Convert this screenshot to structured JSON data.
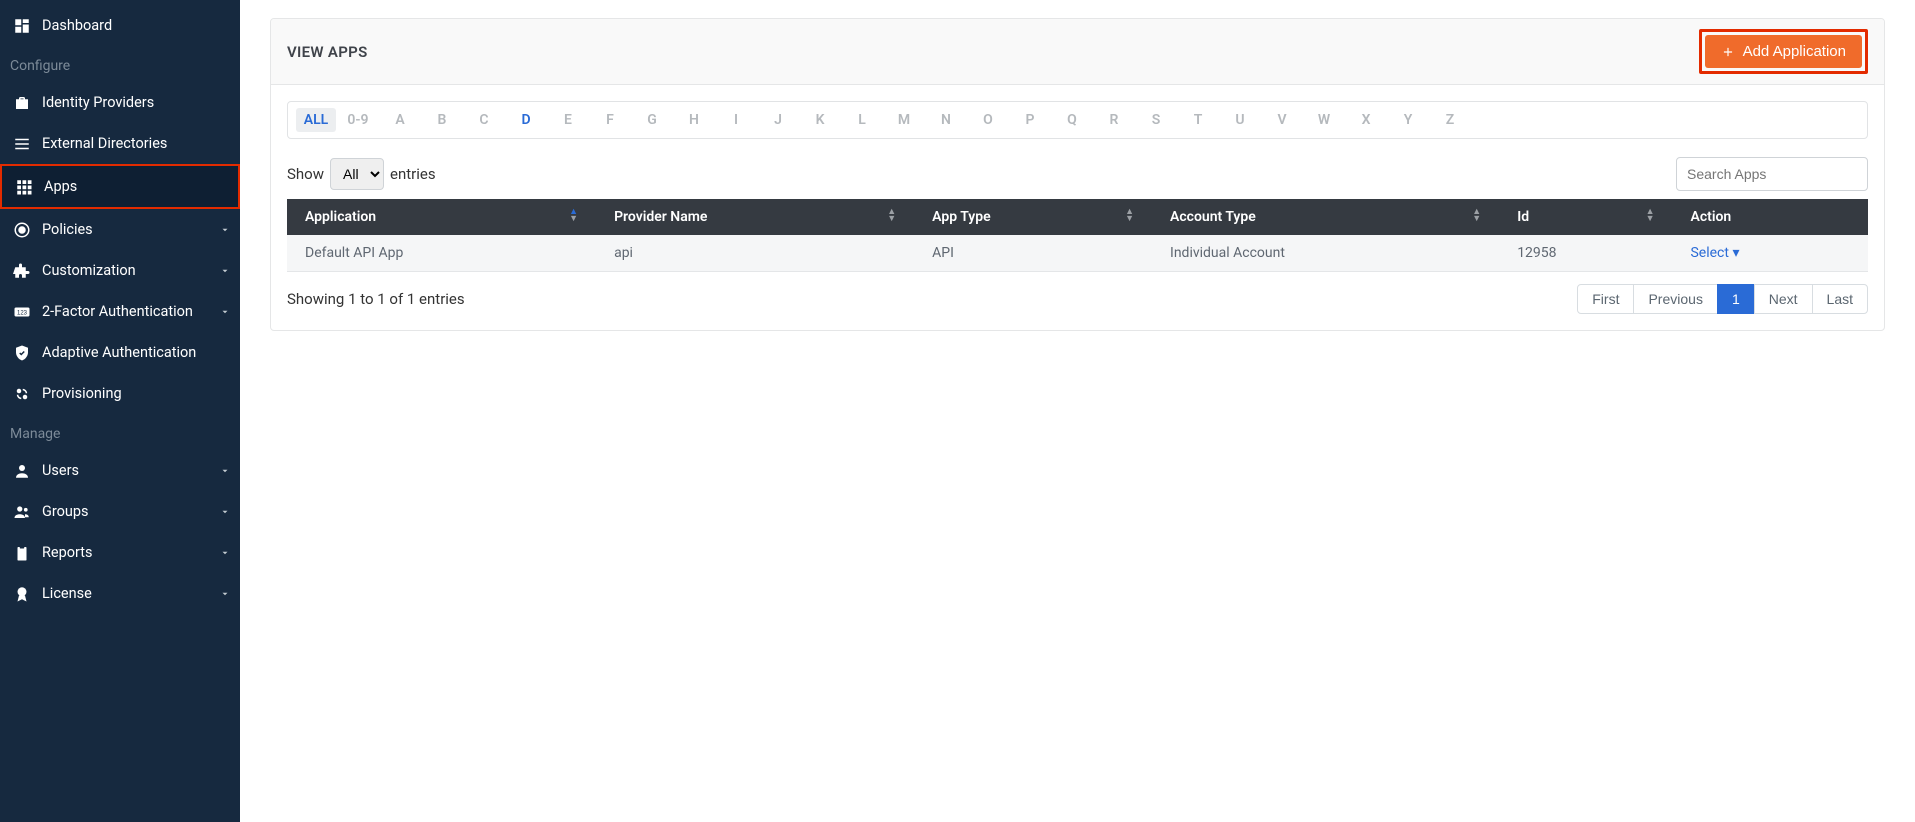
{
  "sidebar": {
    "items": [
      {
        "label": "Dashboard",
        "icon": "dashboard-icon",
        "expandable": false
      },
      {
        "section": "Configure"
      },
      {
        "label": "Identity Providers",
        "icon": "briefcase-icon",
        "expandable": false
      },
      {
        "label": "External Directories",
        "icon": "list-icon",
        "expandable": false
      },
      {
        "label": "Apps",
        "icon": "grid-icon",
        "expandable": false,
        "active": true
      },
      {
        "label": "Policies",
        "icon": "target-icon",
        "expandable": true
      },
      {
        "label": "Customization",
        "icon": "puzzle-icon",
        "expandable": true
      },
      {
        "label": "2-Factor Authentication",
        "icon": "badge123-icon",
        "expandable": true
      },
      {
        "label": "Adaptive Authentication",
        "icon": "shield-check-icon",
        "expandable": false
      },
      {
        "label": "Provisioning",
        "icon": "sync-users-icon",
        "expandable": false
      },
      {
        "section": "Manage"
      },
      {
        "label": "Users",
        "icon": "user-icon",
        "expandable": true
      },
      {
        "label": "Groups",
        "icon": "users-icon",
        "expandable": true
      },
      {
        "label": "Reports",
        "icon": "clipboard-icon",
        "expandable": true
      },
      {
        "label": "License",
        "icon": "award-icon",
        "expandable": true
      }
    ]
  },
  "panel": {
    "title": "VIEW APPS",
    "add_button_label": "Add Application"
  },
  "alpha_filter": [
    "ALL",
    "0-9",
    "A",
    "B",
    "C",
    "D",
    "E",
    "F",
    "G",
    "H",
    "I",
    "J",
    "K",
    "L",
    "M",
    "N",
    "O",
    "P",
    "Q",
    "R",
    "S",
    "T",
    "U",
    "V",
    "W",
    "X",
    "Y",
    "Z"
  ],
  "alpha_selected": "ALL",
  "alpha_current": "D",
  "entries": {
    "show_label": "Show",
    "entries_label": "entries",
    "options": [
      "All"
    ],
    "selected": "All"
  },
  "search_placeholder": "Search Apps",
  "table": {
    "columns": [
      "Application",
      "Provider Name",
      "App Type",
      "Account Type",
      "Id",
      "Action"
    ],
    "sorted_column_index": 0,
    "sorted_dir": "asc",
    "rows": [
      {
        "application": "Default API App",
        "provider_name": "api",
        "app_type": "API",
        "account_type": "Individual Account",
        "id": "12958",
        "action_label": "Select"
      }
    ]
  },
  "info_text": "Showing 1 to 1 of 1 entries",
  "pagination": {
    "first": "First",
    "previous": "Previous",
    "page": "1",
    "next": "Next",
    "last": "Last"
  }
}
